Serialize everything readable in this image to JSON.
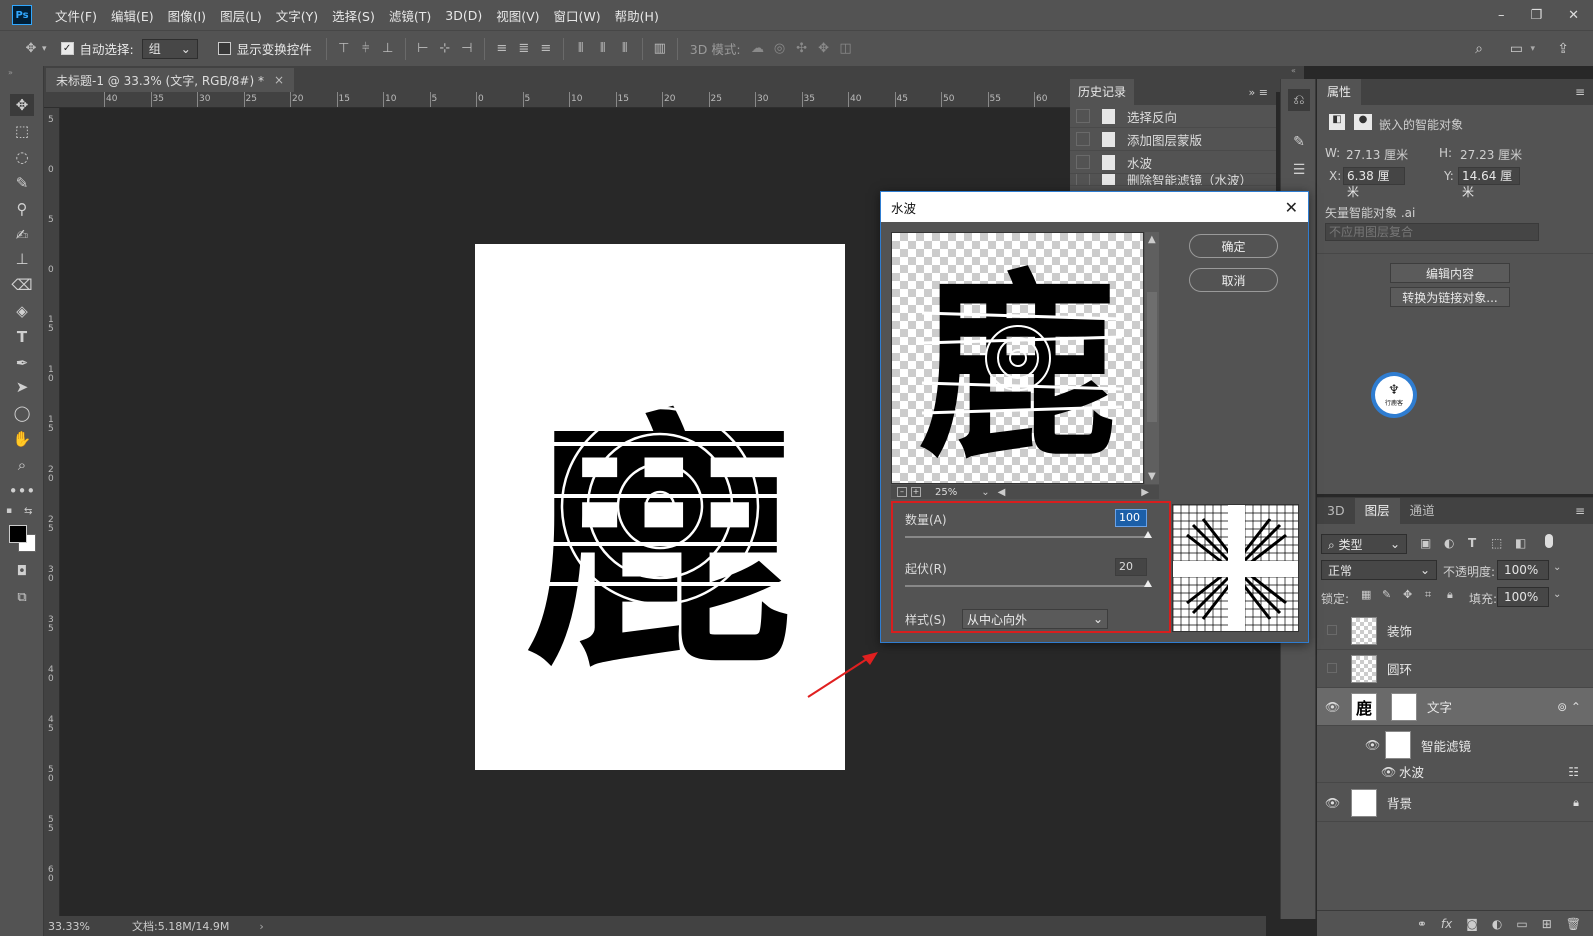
{
  "menubar": {
    "logo": "Ps",
    "items": [
      "文件(F)",
      "编辑(E)",
      "图像(I)",
      "图层(L)",
      "文字(Y)",
      "选择(S)",
      "滤镜(T)",
      "3D(D)",
      "视图(V)",
      "窗口(W)",
      "帮助(H)"
    ],
    "window_controls": [
      "–",
      "❐",
      "✕"
    ]
  },
  "optionsbar": {
    "auto_select_label": "自动选择:",
    "auto_select_checked": true,
    "auto_select_value": "组",
    "show_transform_label": "显示变换控件",
    "show_transform_checked": false,
    "mode_3d_label": "3D 模式:"
  },
  "document": {
    "tab_title": "未标题-1 @ 33.3% (文字, RGB/8#) *",
    "tab_close": "×",
    "glyph": "鹿",
    "zoom_status": "33.33%",
    "doc_status": "文档:5.18M/14.9M",
    "status_arrow": "›",
    "ruler_top": [
      "40",
      "35",
      "30",
      "25",
      "20",
      "15",
      "10",
      "5",
      "0",
      "5",
      "10",
      "15",
      "20",
      "25",
      "30",
      "35",
      "40",
      "45",
      "50",
      "55",
      "60"
    ],
    "ruler_left": [
      "5",
      "0",
      "5",
      "0",
      "1 5",
      "1 0",
      "1 5",
      "2 0",
      "2 5",
      "3 0",
      "3 5",
      "4 0",
      "4 5",
      "5 0",
      "5 5",
      "6 0"
    ]
  },
  "history": {
    "tab_label": "历史记录",
    "items": [
      "选择反向",
      "添加图层蒙版",
      "水波",
      "删除智能滤镜（水波）"
    ]
  },
  "properties": {
    "tab_label": "属性",
    "type_label": "嵌入的智能对象",
    "w_label": "W:",
    "w_value": "27.13 厘米",
    "h_label": "H:",
    "h_value": "27.23 厘米",
    "x_label": "X:",
    "x_value": "6.38 厘米",
    "y_label": "Y:",
    "y_value": "14.64 厘米",
    "source_label": "矢量智能对象 .ai",
    "comp_placeholder": "不应用图层复合",
    "edit_button": "编辑内容",
    "convert_button": "转换为链接对象...",
    "logo_text": "行鹿客"
  },
  "layers": {
    "tabs": [
      "3D",
      "图层",
      "通道"
    ],
    "active_tab": "图层",
    "filter_label": "类型",
    "blend_mode": "正常",
    "opacity_label": "不透明度:",
    "opacity_value": "100%",
    "lock_label": "锁定:",
    "fill_label": "填充:",
    "fill_value": "100%",
    "items": [
      {
        "name": "装饰",
        "visible": false
      },
      {
        "name": "圆环",
        "visible": false
      },
      {
        "name": "文字",
        "visible": true,
        "thumb_glyph": "鹿"
      },
      {
        "name": "智能滤镜",
        "visible": true
      },
      {
        "name": "水波",
        "visible": true
      },
      {
        "name": "背景",
        "visible": true
      }
    ],
    "bottom_icons": [
      "link",
      "fx",
      "mask",
      "adjust",
      "folder",
      "new",
      "trash"
    ]
  },
  "dialog": {
    "title": "水波",
    "close": "✕",
    "ok": "确定",
    "cancel": "取消",
    "preview_zoom": "25%",
    "amount_label": "数量(A)",
    "amount_value": "100",
    "amount_fraction": 1.0,
    "ridges_label": "起伏(R)",
    "ridges_value": "20",
    "ridges_fraction": 1.0,
    "style_label": "样式(S)",
    "style_value": "从中心向外"
  },
  "colors": {
    "accent_blue": "#31a8ff",
    "highlight_red": "#d81e1e",
    "annotation_arrow": "#e02020"
  }
}
